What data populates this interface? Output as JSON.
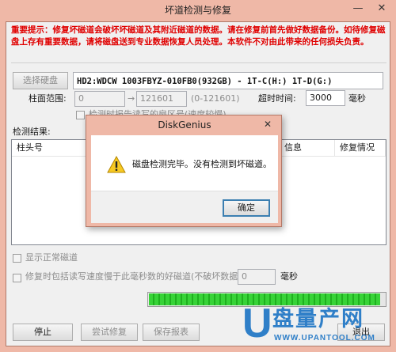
{
  "window": {
    "title": "坏道检测与修复",
    "minimize_glyph": "—",
    "close_glyph": "✕"
  },
  "warning_text": "重要提示：修复坏磁道会破坏坏磁道及其附近磁道的数据。请在修复前首先做好数据备份。如待修复磁盘上存有重要数据，请将磁盘送到专业数据恢复人员处理。本软件不对由此带来的任何损失负责。",
  "disk": {
    "select_button": "选择硬盘",
    "name": "HD2:WDCW  1003FBYZ-010FB0(932GB) - 1T-C(H:) 1T-D(G:)"
  },
  "range": {
    "label": "柱面范围:",
    "from": "0",
    "arrow": "→",
    "to": "121601",
    "hint": "(0-121601)"
  },
  "timeout": {
    "label": "超时时间:",
    "value": "3000",
    "unit": "毫秒"
  },
  "report_option": "检测时报告读写的扇区号(速度较慢)",
  "results": {
    "label": "检测结果:",
    "columns": [
      "柱头号",
      "信息",
      "修复情况"
    ]
  },
  "options": {
    "show_normal": "显示正常磁道",
    "slow_repair_label": "修复时包括读写速度慢于此毫秒数的好磁道(不破坏数据):",
    "slow_value": "0",
    "slow_unit": "毫秒"
  },
  "progress": {
    "fraction": 0.98,
    "color": "#37d337"
  },
  "buttons": {
    "stop": "停止",
    "try_repair": "尝试修复",
    "save_report": "保存报表",
    "exit": "退出"
  },
  "dialog": {
    "title": "DiskGenius",
    "close_glyph": "✕",
    "message": "磁盘检测完毕。没有检测到坏磁道。",
    "ok": "确定",
    "icon": "warning-icon"
  },
  "watermark": {
    "logo_letter": "U",
    "cn_text": "盘量产网",
    "url": "WWW.UPANTOOL.COM"
  },
  "colors": {
    "title_bar": "#efb8a7",
    "warning_red": "#e00000",
    "progress_green": "#37d337",
    "watermark_blue": "#2f7fc8"
  }
}
